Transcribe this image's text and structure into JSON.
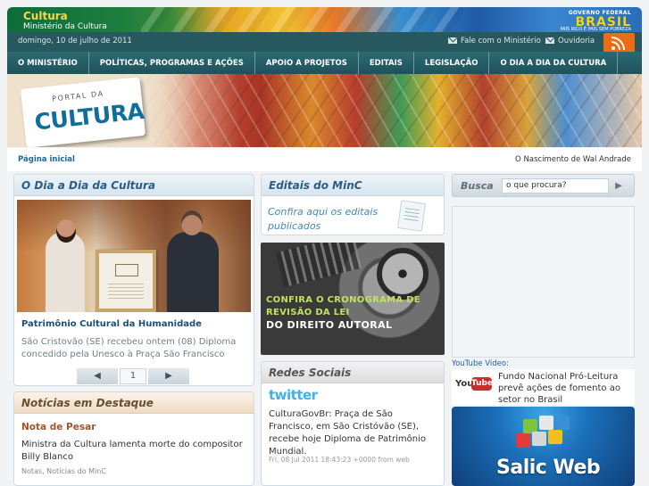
{
  "header": {
    "site_name": "Cultura",
    "site_subtitle": "Ministério da Cultura",
    "gov_line1": "GOVERNO FEDERAL",
    "gov_name": "BRASIL",
    "gov_line3": "PAÍS RICO É PAÍS SEM POBREZA"
  },
  "infobar": {
    "date": "domingo, 10 de julho de 2011",
    "fale": "Fale com o Ministério",
    "ouvidoria": "Ouvidoria"
  },
  "nav": [
    {
      "label": "O MINISTÉRIO"
    },
    {
      "label": "POLÍTICAS, PROGRAMAS E AÇÕES"
    },
    {
      "label": "APOIO A PROJETOS"
    },
    {
      "label": "EDITAIS"
    },
    {
      "label": "LEGISLAÇÃO"
    },
    {
      "label": "O DIA A DIA DA CULTURA"
    }
  ],
  "hero": {
    "logo_top": "PORTAL DA",
    "logo_main": "CULTURA"
  },
  "breadcrumb": {
    "home": "Página inicial",
    "ticker": "O Nascimento de Wal Andrade"
  },
  "dia_a_dia": {
    "heading": "O Dia a Dia da Cultura",
    "title": "Patrimônio Cultural da Humanidade",
    "text": "São Cristovão (SE) recebeu ontem (08) Diploma concedido pela Unesco à Praça São Francisco",
    "page": "1",
    "prev": "◀",
    "next": "▶"
  },
  "destaque": {
    "heading": "Notícias em Destaque",
    "kicker": "Nota de Pesar",
    "text": "Ministra da Cultura lamenta morte do compositor Billy Blanco",
    "meta": "Notas, Notícias do MinC"
  },
  "editais": {
    "heading": "Editais do MinC",
    "link": "Confira aqui os editais publicados"
  },
  "direito_autoral": {
    "line1": "CONFIRA O CRONOGRAMA DE REVISÃO DA LEI",
    "line2": "DO DIREITO AUTORAL"
  },
  "redes": {
    "heading": "Redes Sociais",
    "twitter": "twitter",
    "tweet": "CulturaGovBr: Praça de São Francisco, em São Cristóvão (SE), recebe hoje Diploma de Patrimônio Mundial.",
    "tweet_meta": "Fri, 08 Jul 2011 18:43:23 +0000 from web"
  },
  "busca": {
    "label": "Busca",
    "placeholder": "o que procura?",
    "button": "▶"
  },
  "youtube": {
    "caption": "YouTube Video:",
    "logo_you": "You",
    "logo_tube": "Tube",
    "text": "Fundo Nacional Pró-Leitura prevê ações de fomento ao setor no Brasil"
  },
  "salic": {
    "label": "Salic Web"
  },
  "colors": {
    "nav_bg": "#1f525a",
    "link_blue": "#1c6a9c",
    "accent_orange": "#ee6c14",
    "twitter_blue": "#41b1e3",
    "youtube_red": "#c4302b"
  }
}
